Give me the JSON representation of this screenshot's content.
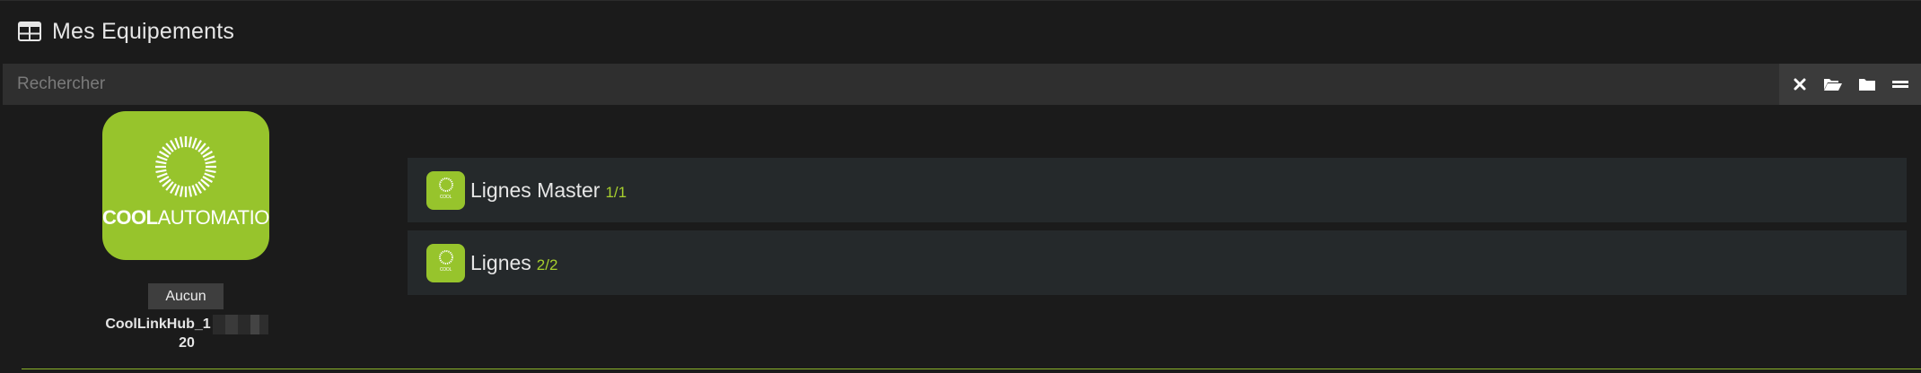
{
  "header": {
    "title": "Mes Equipements",
    "icon": "table-grid-icon"
  },
  "search": {
    "placeholder": "Rechercher",
    "value": "",
    "actions": [
      {
        "name": "clear-search-button",
        "icon": "close-icon"
      },
      {
        "name": "open-folders-button",
        "icon": "folder-open-icon"
      },
      {
        "name": "close-folders-button",
        "icon": "folder-icon"
      },
      {
        "name": "toggle-view-button",
        "icon": "equals-icon"
      }
    ]
  },
  "plugin": {
    "brand_bold": "COOL",
    "brand_light": "AUTOMATION",
    "object": "Aucun",
    "device_name_prefix": "CoolLinkHub_1",
    "device_name_suffix": "20"
  },
  "equipments": [
    {
      "name": "Lignes Master",
      "count": "1/1"
    },
    {
      "name": "Lignes",
      "count": "2/2"
    }
  ],
  "colors": {
    "accent": "#97c42c",
    "count": "#a7cf2e",
    "background": "#1b1b1b",
    "row": "#25292b"
  }
}
